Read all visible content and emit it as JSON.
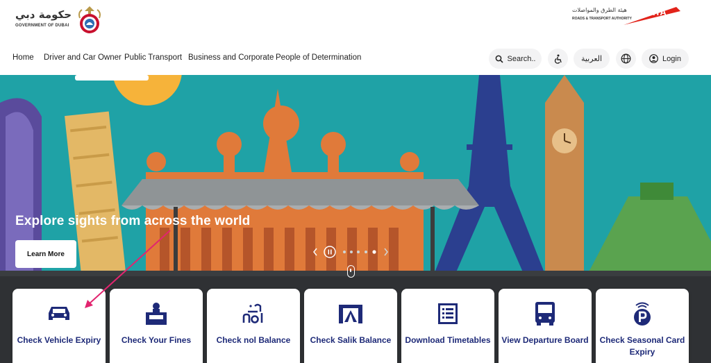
{
  "header": {
    "gov_logo_ar": "حكومة دبي",
    "gov_logo_en": "GOVERNMENT OF DUBAI",
    "rta_logo_ar": "هيئة الطرق والمواصلات",
    "rta_logo_en": "ROADS & TRANSPORT AUTHORITY",
    "rta_mark": "RTA"
  },
  "nav": {
    "items": [
      {
        "label": "Home"
      },
      {
        "label": "Driver and Car Owner"
      },
      {
        "label": "Public Transport"
      },
      {
        "label": "Business and Corporate"
      },
      {
        "label": "People of Determination"
      }
    ],
    "search_label": "Search..",
    "arabic_label": "العربية",
    "login_label": "Login"
  },
  "hero": {
    "title": "Explore sights from across the world",
    "learn_more_label": "Learn More"
  },
  "services": [
    {
      "label": "Check Vehicle Expiry",
      "icon": "car-icon"
    },
    {
      "label": "Check Your Fines",
      "icon": "fine-ticket-icon"
    },
    {
      "label": "Check nol Balance",
      "icon": "nol-icon"
    },
    {
      "label": "Check Salik Balance",
      "icon": "salik-gate-icon"
    },
    {
      "label": "Download Timetables",
      "icon": "timetable-icon"
    },
    {
      "label": "View Departure Board",
      "icon": "bus-icon"
    },
    {
      "label": "Check Seasonal Card Expiry",
      "icon": "parking-card-icon"
    }
  ],
  "colors": {
    "accent": "#1e2a78",
    "rta_red": "#e2231a",
    "hero_teal": "#1fa2a6",
    "annotation_arrow": "#e2246f"
  }
}
